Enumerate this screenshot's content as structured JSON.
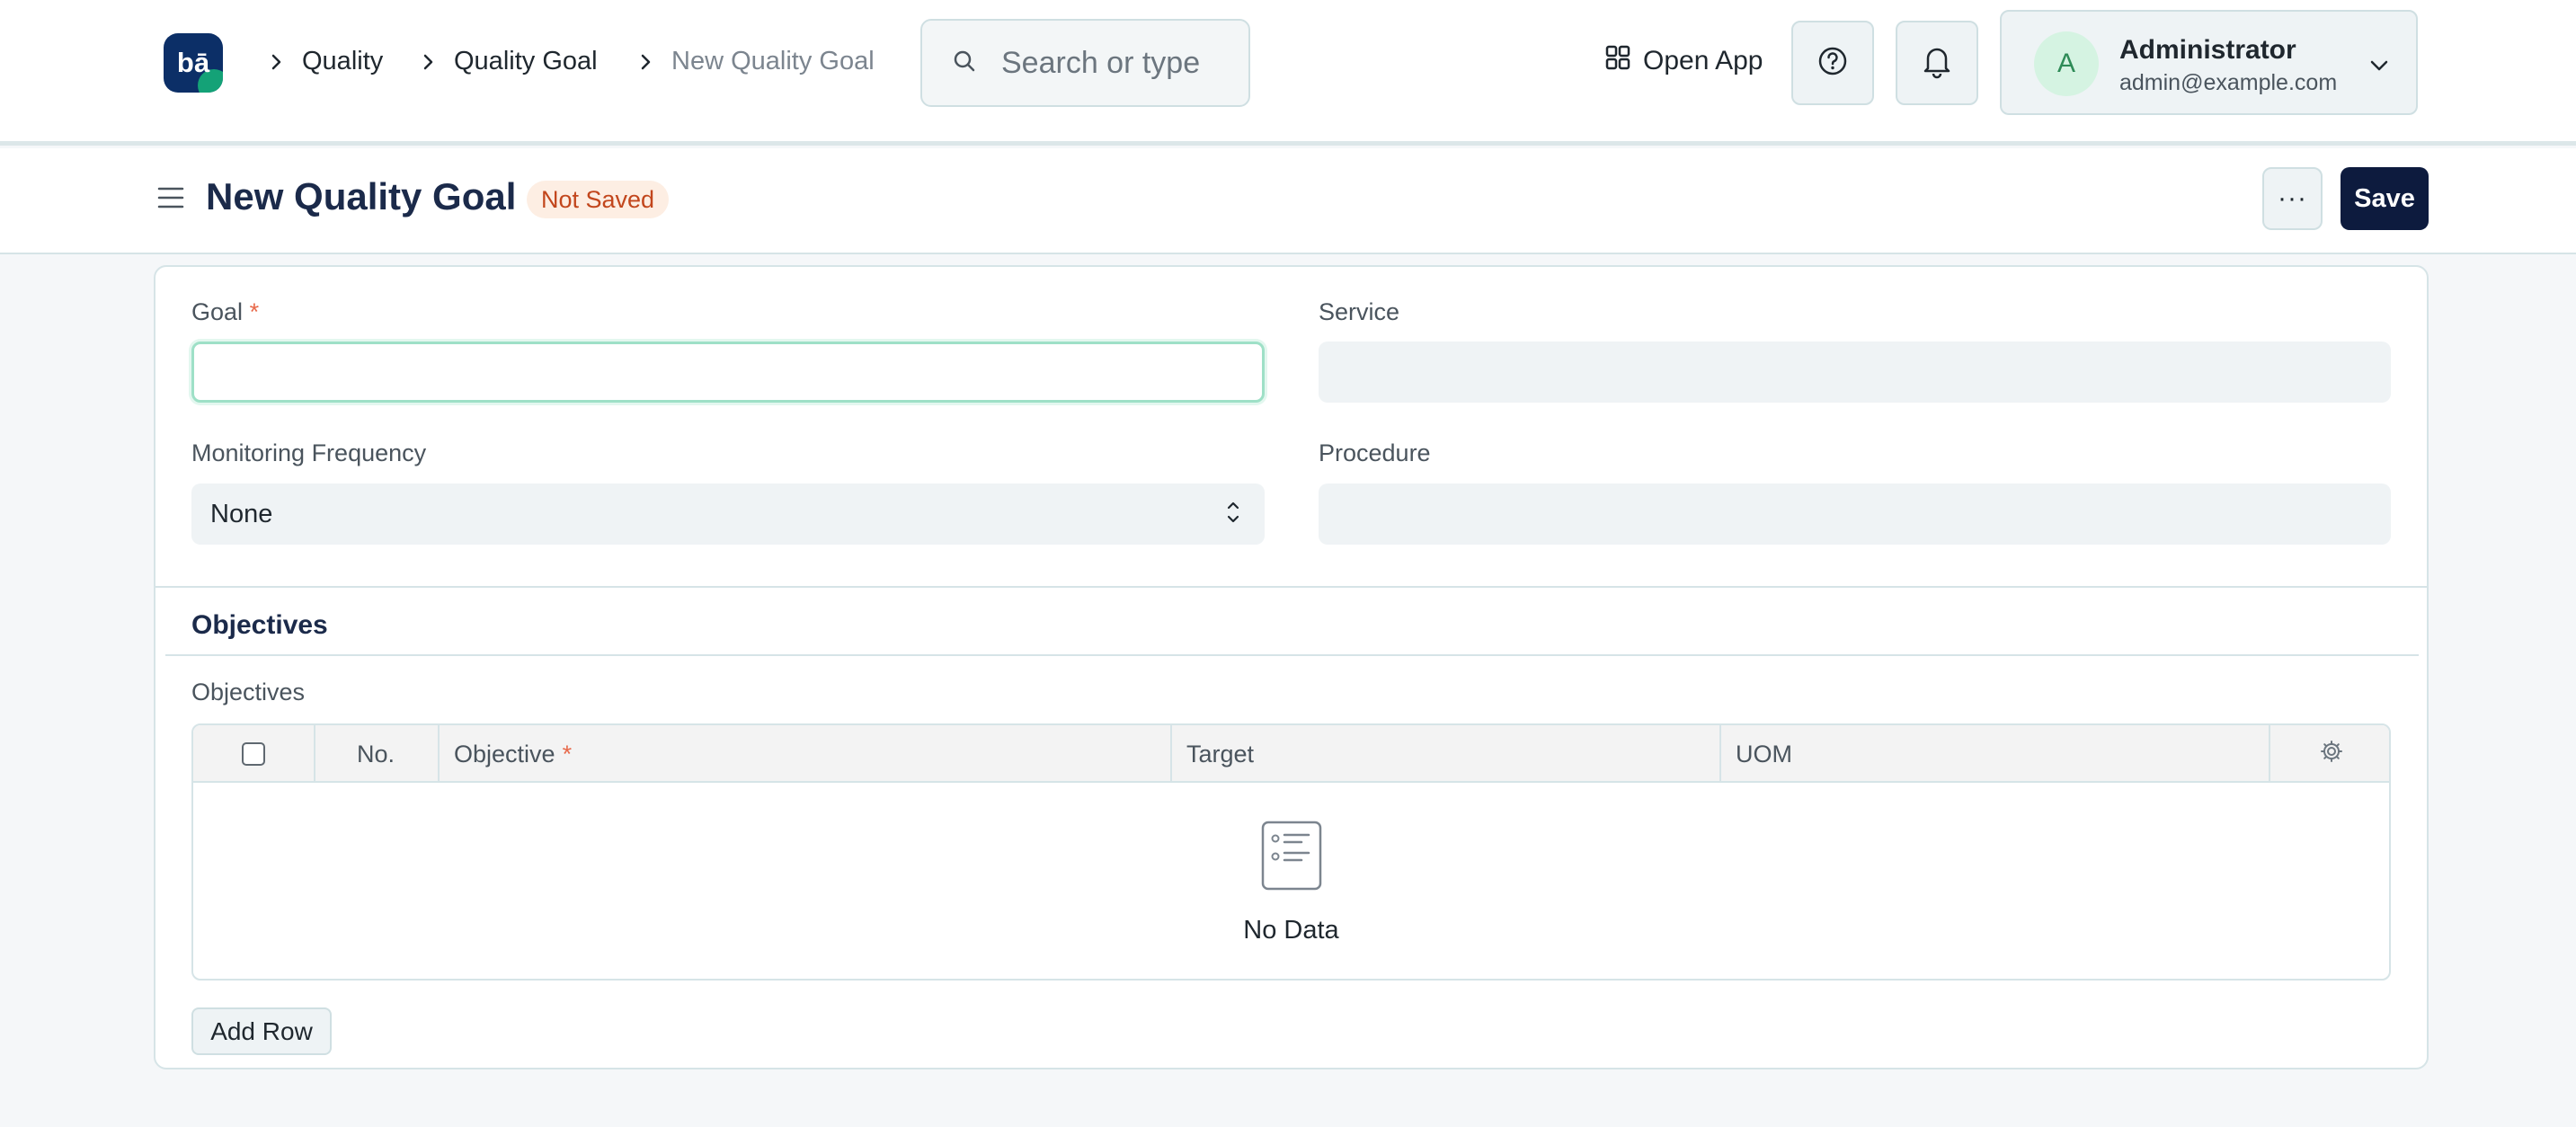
{
  "navbar": {
    "logo_text": "bā",
    "breadcrumbs": [
      {
        "label": "Quality"
      },
      {
        "label": "Quality Goal"
      },
      {
        "label": "New Quality Goal"
      }
    ],
    "search_placeholder": "Search or type",
    "open_app_label": "Open App",
    "help_icon": "help-circle-icon",
    "notification_icon": "bell-icon",
    "user": {
      "initial": "A",
      "name": "Administrator",
      "email": "admin@example.com"
    }
  },
  "page_header": {
    "title": "New Quality Goal",
    "status_badge": "Not Saved",
    "more_label": "···",
    "save_label": "Save"
  },
  "form": {
    "goal": {
      "label": "Goal",
      "required_mark": "*",
      "value": ""
    },
    "service": {
      "label": "Service",
      "value": ""
    },
    "monitoring_frequency": {
      "label": "Monitoring Frequency",
      "value": "None"
    },
    "procedure": {
      "label": "Procedure",
      "value": ""
    }
  },
  "objectives_section": {
    "title": "Objectives",
    "table_label": "Objectives",
    "columns": [
      {
        "label": "No."
      },
      {
        "label": "Objective",
        "required_mark": "*"
      },
      {
        "label": "Target"
      },
      {
        "label": "UOM"
      }
    ],
    "empty_text": "No Data",
    "add_row_label": "Add Row"
  },
  "colors": {
    "primary": "#0d1b3e",
    "badge_text": "#c2461c",
    "badge_bg": "#fdeee3",
    "focus_border": "#9ee0c7",
    "required": "#e8694a"
  }
}
